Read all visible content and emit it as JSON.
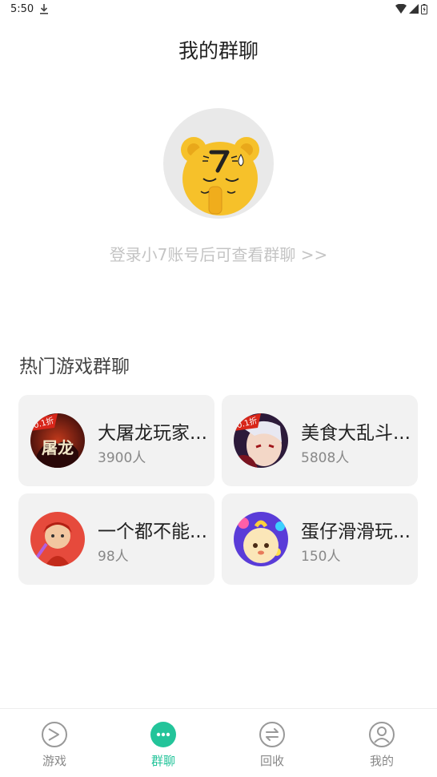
{
  "status_bar": {
    "time": "5:50"
  },
  "page": {
    "title": "我的群聊",
    "login_prompt": "登录小7账号后可查看群聊 >>"
  },
  "section": {
    "title": "热门游戏群聊"
  },
  "groups": [
    {
      "name": "大屠龙玩家...",
      "count": "3900人",
      "badge": "0.1折",
      "avatar_text": "屠龙"
    },
    {
      "name": "美食大乱斗...",
      "count": "5808人",
      "badge": "0.1折"
    },
    {
      "name": "一个都不能...",
      "count": "98人"
    },
    {
      "name": "蛋仔滑滑玩...",
      "count": "150人"
    }
  ],
  "bottom_nav": {
    "items": [
      {
        "label": "游戏",
        "icon": "game-icon",
        "active": false
      },
      {
        "label": "群聊",
        "icon": "chat-icon",
        "active": true
      },
      {
        "label": "回收",
        "icon": "recycle-icon",
        "active": false
      },
      {
        "label": "我的",
        "icon": "profile-icon",
        "active": false
      }
    ]
  },
  "colors": {
    "accent": "#23c49a",
    "mascot_yellow": "#f6c12a",
    "card_bg": "#f2f2f2",
    "muted_text": "#c4c4c4"
  }
}
